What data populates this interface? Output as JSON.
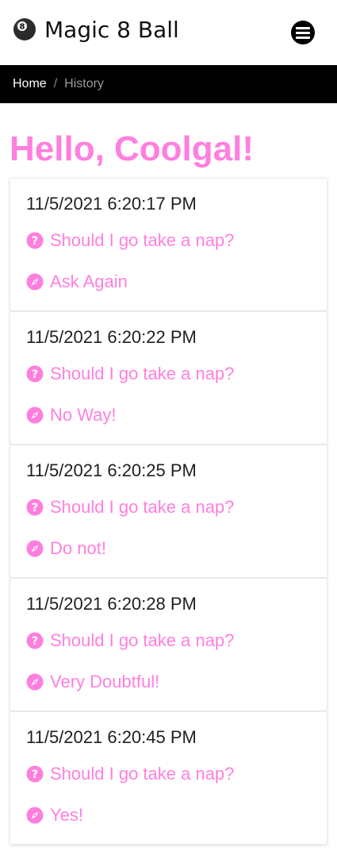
{
  "header": {
    "title": "Magic 8 Ball",
    "logo_icon": "magic-8-ball-icon",
    "menu_icon": "hamburger-menu-icon"
  },
  "breadcrumb": {
    "home": "Home",
    "separator": "/",
    "current": "History"
  },
  "greeting": "Hello, Coolgal!",
  "colors": {
    "accent": "#ff7fdf",
    "breadcrumb_bg": "#000000",
    "text": "#1f1f1f"
  },
  "history": [
    {
      "timestamp": "11/5/2021 6:20:17 PM",
      "question": "Should I go take a nap?",
      "answer": "Ask Again",
      "question_icon": "question-circle-icon",
      "answer_icon": "compass-icon"
    },
    {
      "timestamp": "11/5/2021 6:20:22 PM",
      "question": "Should I go take a nap?",
      "answer": "No Way!",
      "question_icon": "question-circle-icon",
      "answer_icon": "compass-icon"
    },
    {
      "timestamp": "11/5/2021 6:20:25 PM",
      "question": "Should I go take a nap?",
      "answer": "Do not!",
      "question_icon": "question-circle-icon",
      "answer_icon": "compass-icon"
    },
    {
      "timestamp": "11/5/2021 6:20:28 PM",
      "question": "Should I go take a nap?",
      "answer": "Very Doubtful!",
      "question_icon": "question-circle-icon",
      "answer_icon": "compass-icon"
    },
    {
      "timestamp": "11/5/2021 6:20:45 PM",
      "question": "Should I go take a nap?",
      "answer": "Yes!",
      "question_icon": "question-circle-icon",
      "answer_icon": "compass-icon"
    }
  ]
}
